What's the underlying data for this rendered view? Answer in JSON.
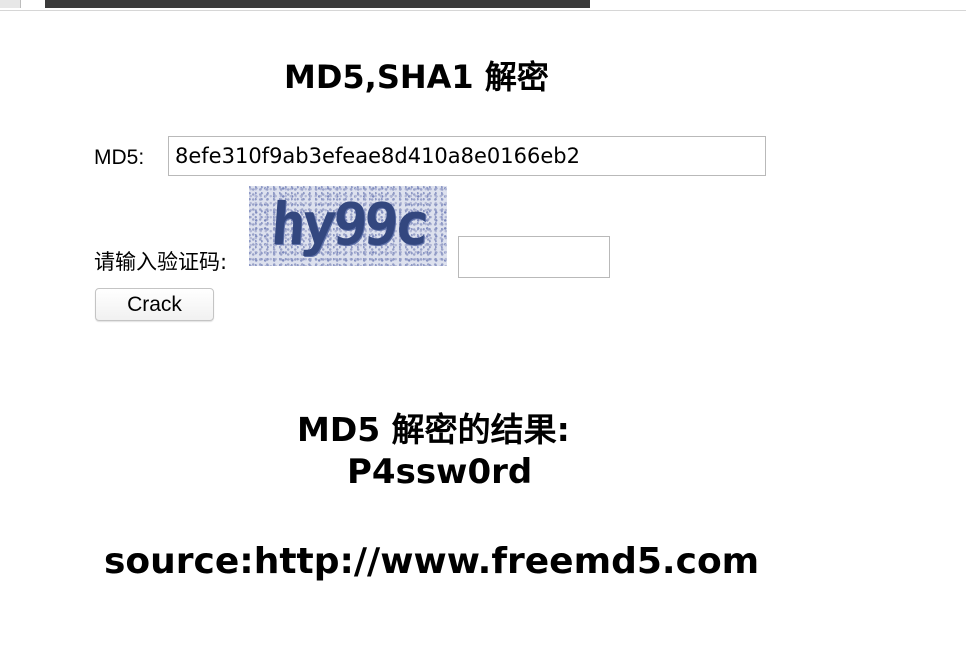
{
  "page": {
    "title": "MD5,SHA1 解密"
  },
  "form": {
    "md5_label": "MD5:",
    "md5_value": "8efe310f9ab3efeae8d410a8e0166eb2",
    "captcha_label": "请输入验证码:",
    "captcha_text": "hy99c",
    "captcha_value": "",
    "crack_label": "Crack"
  },
  "result": {
    "heading": "MD5 解密的结果:",
    "value": "P4ssw0rd",
    "source": "source:http://www.freemd5.com"
  },
  "colors": {
    "captcha_text": "#33477f",
    "captcha_background": "#dde1ee",
    "input_border": "#b9b9b9"
  }
}
